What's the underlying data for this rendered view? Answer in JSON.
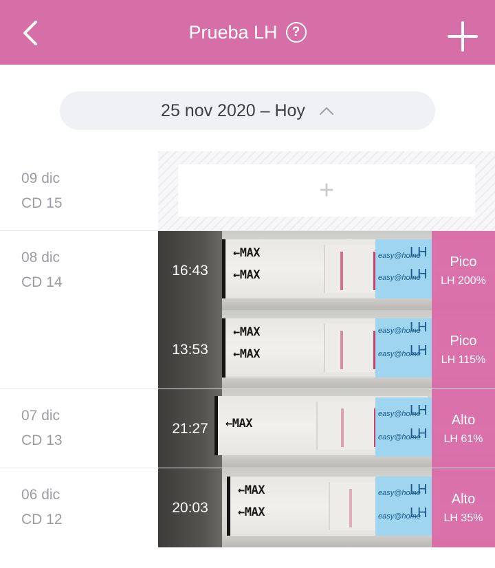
{
  "header": {
    "title": "Prueba LH",
    "help_icon": "question-circle-icon",
    "back_icon": "chevron-left-icon",
    "add_icon": "plus-icon",
    "color": "#d66fa8"
  },
  "date_selector": {
    "label": "25 nov 2020 – Hoy",
    "icon": "chevron-up-icon"
  },
  "days": [
    {
      "date": "09 dic",
      "cycle_day": "CD 15",
      "tests": []
    },
    {
      "date": "08 dic",
      "cycle_day": "CD 14",
      "tests": [
        {
          "time": "16:43",
          "level": "Pico",
          "lh": "LH 200%"
        },
        {
          "time": "13:53",
          "level": "Pico",
          "lh": "LH 115%"
        }
      ]
    },
    {
      "date": "07 dic",
      "cycle_day": "CD 13",
      "tests": [
        {
          "time": "21:27",
          "level": "Alto",
          "lh": "LH 61%"
        }
      ]
    },
    {
      "date": "06 dic",
      "cycle_day": "CD 12",
      "tests": [
        {
          "time": "20:03",
          "level": "Alto",
          "lh": "LH 35%"
        }
      ]
    }
  ],
  "strip": {
    "max_label": "←MAX",
    "brand": "easy@home",
    "brand_lh": "LH"
  },
  "empty_slot": {
    "icon": "plus-icon",
    "label": "+"
  }
}
